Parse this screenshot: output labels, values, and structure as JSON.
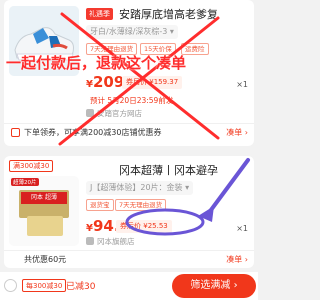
{
  "item1": {
    "badge": "礼遇季",
    "title": "安踏厚底增高老爹复",
    "spec": "牙白/水薄绿/深灰棕-3",
    "tags": [
      "7天无理由退货",
      "15天价保",
      "运费险"
    ],
    "price_symbol": "¥",
    "price": "209",
    "est_label": "券后价",
    "est_price": "¥159.37",
    "presale": "预计 5月20日23:59前发",
    "shop": "安踏官方网店",
    "qty": "×1"
  },
  "promo1": {
    "text": "下单领券，可享满200减30店铺优惠券",
    "link": "凑单"
  },
  "item2": {
    "badge": "满300减30",
    "title": "冈本超薄丨冈本避孕",
    "spec": "J【超薄体验】20片：金装",
    "tags": [
      "退货宝",
      "7天无理由退货"
    ],
    "price_symbol": "¥",
    "price": "94.9",
    "est_label": "券后价",
    "est_price": "¥25.53",
    "shop": "冈本旗舰店",
    "qty": "×1",
    "product_text": "冈本 超薄",
    "pack_badge": "超薄20片"
  },
  "promo2": {
    "text": "共优惠60元",
    "link": "凑单"
  },
  "annotation": {
    "text": "一起付款后，退款这个凑单"
  },
  "bottom_bar": {
    "badge": "每300减30",
    "status": "已减30",
    "button": "筛选满减"
  },
  "colors": {
    "accent": "#f1371b",
    "annotation": "#ff2d2d",
    "circle": "#6a55d6"
  }
}
